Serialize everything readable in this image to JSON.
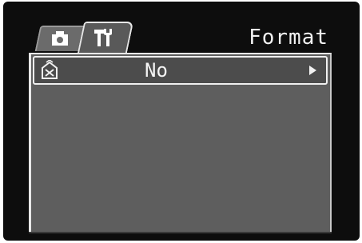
{
  "header": {
    "title": "Format"
  },
  "tabs": [
    {
      "icon": "camera-icon",
      "selected": false
    },
    {
      "icon": "tools-icon",
      "selected": true
    }
  ],
  "menu": {
    "items": [
      {
        "icon": "format-card-icon",
        "value": "No",
        "arrow": "right-arrow-icon"
      }
    ]
  },
  "colors": {
    "background": "#0d0d0d",
    "panel": "#5e5e5e",
    "text": "#f2f2f2",
    "highlight_border": "#f0f0f0"
  }
}
